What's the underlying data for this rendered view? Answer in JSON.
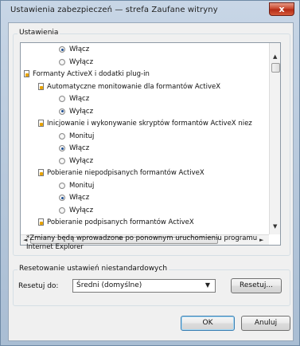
{
  "window": {
    "title": "Ustawienia zabezpieczeń — strefa Zaufane witryny",
    "close_glyph": "x"
  },
  "settings_group": {
    "title": "Ustawienia",
    "rows": [
      {
        "kind": "radio",
        "label": "Włącz",
        "checked": true
      },
      {
        "kind": "radio",
        "label": "Wyłącz",
        "checked": false
      },
      {
        "kind": "category",
        "label": "Formanty ActiveX i dodatki plug-in"
      },
      {
        "kind": "feature",
        "label": "Automatyczne monitowanie dla formantów ActiveX"
      },
      {
        "kind": "radio",
        "label": "Włącz",
        "checked": false
      },
      {
        "kind": "radio",
        "label": "Wyłącz",
        "checked": true
      },
      {
        "kind": "feature",
        "label": "Inicjowanie i wykonywanie skryptów formantów ActiveX niez"
      },
      {
        "kind": "radio",
        "label": "Monituj",
        "checked": false
      },
      {
        "kind": "radio",
        "label": "Włącz",
        "checked": true
      },
      {
        "kind": "radio",
        "label": "Wyłącz",
        "checked": false
      },
      {
        "kind": "feature",
        "label": "Pobieranie niepodpisanych formantów ActiveX"
      },
      {
        "kind": "radio",
        "label": "Monituj",
        "checked": false
      },
      {
        "kind": "radio",
        "label": "Włącz",
        "checked": true
      },
      {
        "kind": "radio",
        "label": "Wyłącz",
        "checked": false
      },
      {
        "kind": "feature",
        "label": "Pobieranie podpisanych formantów ActiveX"
      }
    ],
    "note": "*Zmiany będą wprowadzone po ponownym uruchomieniu programu Internet Explorer"
  },
  "reset_group": {
    "title": "Resetowanie ustawień niestandardowych",
    "reset_to_label": "Resetuj do:",
    "selected_level": "Średni (domyślne)",
    "reset_button": "Resetuj..."
  },
  "footer": {
    "ok_button": "OK",
    "cancel_button": "Anuluj"
  },
  "scrollbar_glyphs": {
    "up": "▲",
    "down": "▼",
    "left": "◄",
    "right": "►",
    "grip": "III"
  }
}
